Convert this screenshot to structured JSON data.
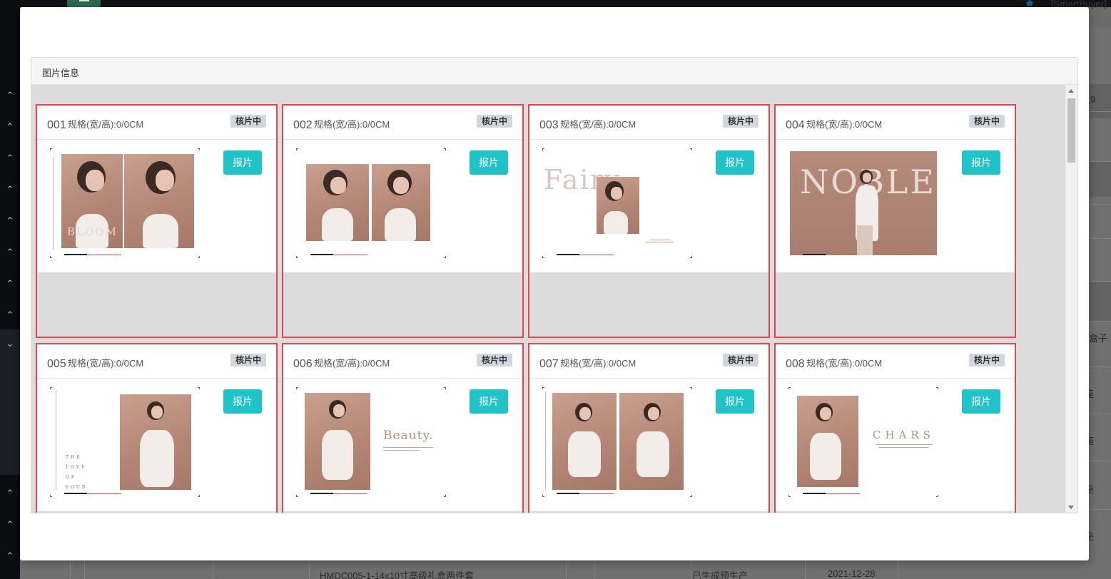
{
  "background": {
    "user_label": "[SmartBuyer]",
    "right_column_texts": [
      "9",
      "盒子",
      "座",
      "座",
      "座",
      "座"
    ],
    "bottom_row": {
      "product": "HMDC005-1-14x10寸高级礼盒两件套",
      "status": "已生成预生产",
      "date": "2021-12-28"
    }
  },
  "panel": {
    "title": "图片信息"
  },
  "cards": [
    {
      "number": "001",
      "spec": "规格(宽/高):0/0CM",
      "status": "核片中",
      "action": "报片",
      "thumb_text": "BLOOM"
    },
    {
      "number": "002",
      "spec": "规格(宽/高):0/0CM",
      "status": "核片中",
      "action": "报片",
      "thumb_text": ""
    },
    {
      "number": "003",
      "spec": "规格(宽/高):0/0CM",
      "status": "核片中",
      "action": "报片",
      "thumb_text": "Fairy"
    },
    {
      "number": "004",
      "spec": "规格(宽/高):0/0CM",
      "status": "核片中",
      "action": "报片",
      "thumb_text": "NOBLE"
    },
    {
      "number": "005",
      "spec": "规格(宽/高):0/0CM",
      "status": "核片中",
      "action": "报片",
      "thumb_text": "THE LOVE OF YOUR"
    },
    {
      "number": "006",
      "spec": "规格(宽/高):0/0CM",
      "status": "核片中",
      "action": "报片",
      "thumb_text": "Beauty."
    },
    {
      "number": "007",
      "spec": "规格(宽/高):0/0CM",
      "status": "核片中",
      "action": "报片",
      "thumb_text": ""
    },
    {
      "number": "008",
      "spec": "规格(宽/高):0/0CM",
      "status": "核片中",
      "action": "报片",
      "thumb_text": "CHARS"
    }
  ]
}
